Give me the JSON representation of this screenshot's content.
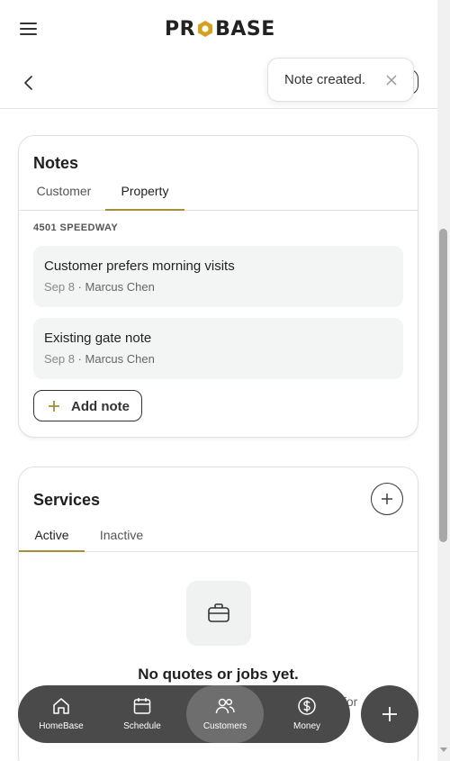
{
  "header": {
    "logo_text": [
      "PR",
      "BASE"
    ],
    "logo_accent_color": "#d6a21e"
  },
  "toast": {
    "message": "Note created."
  },
  "notes_card": {
    "title": "Notes",
    "tabs": [
      {
        "label": "Customer",
        "active": false
      },
      {
        "label": "Property",
        "active": true
      }
    ],
    "address": "4501 SPEEDWAY",
    "notes": [
      {
        "text": "Customer prefers morning visits",
        "date": "Sep 8",
        "author": "Marcus Chen"
      },
      {
        "text": "Existing gate note",
        "date": "Sep 8",
        "author": "Marcus Chen"
      }
    ],
    "meta_separator": " · ",
    "add_note_label": "Add note"
  },
  "services_card": {
    "title": "Services",
    "tabs": [
      {
        "label": "Active",
        "active": true
      },
      {
        "label": "Inactive",
        "active": false
      }
    ],
    "empty_title": "No quotes or jobs yet.",
    "empty_subtitle_visible": "for"
  },
  "bottom_nav": {
    "items": [
      {
        "label": "HomeBase",
        "icon": "home-icon",
        "active": false
      },
      {
        "label": "Schedule",
        "icon": "calendar-icon",
        "active": false
      },
      {
        "label": "Customers",
        "icon": "users-icon",
        "active": true
      },
      {
        "label": "Money",
        "icon": "dollar-icon",
        "active": false
      }
    ]
  },
  "colors": {
    "accent": "#a88d3a",
    "nav_bg": "#4a4a4a",
    "nav_active": "#6e6e6e",
    "note_bg": "#f3f4f4"
  }
}
